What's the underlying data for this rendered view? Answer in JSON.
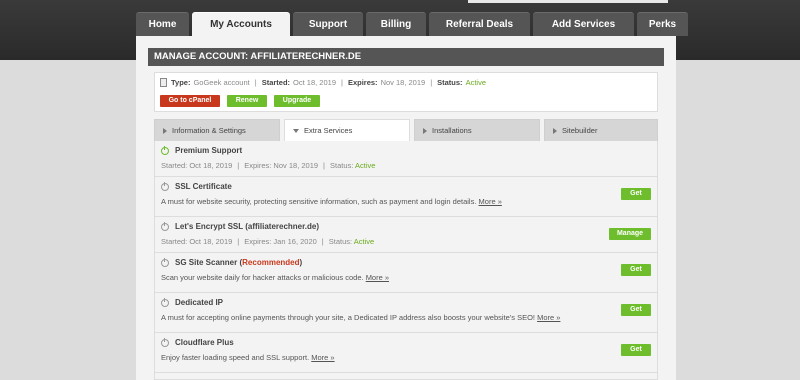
{
  "nav": {
    "tabs": [
      {
        "label": "Home",
        "active": false
      },
      {
        "label": "My Accounts",
        "active": true
      },
      {
        "label": "Support",
        "active": false
      },
      {
        "label": "Billing",
        "active": false
      },
      {
        "label": "Referral Deals",
        "active": false
      },
      {
        "label": "Add Services",
        "active": false
      },
      {
        "label": "Perks",
        "active": false
      }
    ]
  },
  "panel": {
    "title": "MANAGE ACCOUNT: AFFILIATERECHNER.DE"
  },
  "account": {
    "type_label": "Type:",
    "type_value": "GoGeek account",
    "started_label": "Started:",
    "started_value": "Oct 18, 2019",
    "expires_label": "Expires:",
    "expires_value": "Nov 18, 2019",
    "status_label": "Status:",
    "status_value": "Active",
    "buttons": {
      "cpanel": "Go to cPanel",
      "renew": "Renew",
      "upgrade": "Upgrade"
    }
  },
  "subtabs": [
    {
      "label": "Information & Settings",
      "active": false
    },
    {
      "label": "Extra Services",
      "active": true
    },
    {
      "label": "Installations",
      "active": false
    },
    {
      "label": "Sitebuilder",
      "active": false
    }
  ],
  "services": [
    {
      "title": "Premium Support",
      "active": true,
      "started": "Started: Oct 18, 2019",
      "expires": "Expires: Nov 18, 2019",
      "status_label": "Status:",
      "status_value": "Active"
    },
    {
      "title": "SSL Certificate",
      "desc": "A must for website security, protecting sensitive information, such as payment and login details.",
      "more": "More »",
      "button": "Get"
    },
    {
      "title": "Let's Encrypt SSL (affiliaterechner.de)",
      "started": "Started: Oct 18, 2019",
      "expires": "Expires: Jan 16, 2020",
      "status_label": "Status:",
      "status_value": "Active",
      "button": "Manage"
    },
    {
      "title": "SG Site Scanner",
      "title_open": "(",
      "recommended": "Recommended",
      "title_close": ")",
      "desc": "Scan your website daily for hacker attacks or malicious code.",
      "more": "More »",
      "button": "Get"
    },
    {
      "title": "Dedicated IP",
      "desc": "A must for accepting online payments through your site, a Dedicated IP address also boosts your website's SEO!",
      "more": "More »",
      "button": "Get"
    },
    {
      "title": "Cloudflare Plus",
      "desc": "Enjoy faster loading speed and SSL support.",
      "more": "More »",
      "button": "Get"
    }
  ],
  "colors": {
    "accent_green": "#6dbd2c",
    "accent_red": "#c8381c",
    "header_dark": "#555555"
  }
}
